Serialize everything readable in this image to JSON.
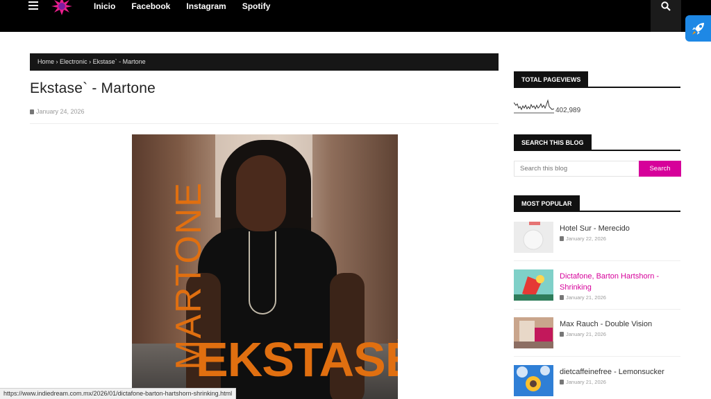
{
  "nav": {
    "items": [
      "Inicio",
      "Facebook",
      "Instagram",
      "Spotify"
    ]
  },
  "breadcrumb": {
    "home": "Home",
    "sep": "›",
    "category": "Electronic",
    "current": "Ekstase` - Martone"
  },
  "post": {
    "title": "Ekstase` - Martone",
    "date": "January 24, 2026",
    "cover_text_vertical": "MARTONE",
    "cover_text_horizontal": "EKSTASÉ"
  },
  "sidebar": {
    "pageviews": {
      "heading": "TOTAL PAGEVIEWS",
      "count": "402,989"
    },
    "search": {
      "heading": "SEARCH THIS BLOG",
      "placeholder": "Search this blog",
      "button": "Search"
    },
    "popular": {
      "heading": "MOST POPULAR",
      "items": [
        {
          "title": "Hotel Sur - Merecido",
          "date": "January 22, 2026"
        },
        {
          "title": "Dictafone, Barton Hartshorn - Shrinking",
          "date": "January 21, 2026"
        },
        {
          "title": "Max Rauch - Double Vision",
          "date": "January 21, 2026"
        },
        {
          "title": "dietcaffeinefree - Lemonsucker",
          "date": "January 21, 2026"
        }
      ]
    }
  },
  "status_url": "https://www.indiedream.com.mx/2026/01/dictafone-barton-hartshorn-shrinking.html",
  "colors": {
    "accent": "#d6019a",
    "topbar": "#000000",
    "cover_text": "#e06f10"
  }
}
